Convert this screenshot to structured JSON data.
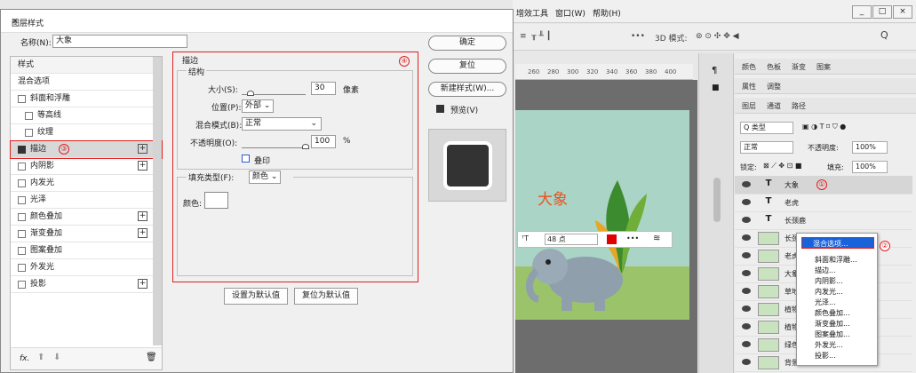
{
  "ps": {
    "menu": [
      "增效工具",
      "窗口(W)",
      "帮助(H)"
    ],
    "window_controls": [
      "_",
      "□",
      "×"
    ],
    "options": {
      "mode_3d": "3D 模式:",
      "more": "•••"
    },
    "ruler": [
      "260",
      "280",
      "300",
      "320",
      "340",
      "360",
      "380",
      "400"
    ],
    "canvas_title": "大象",
    "floatbar": {
      "font_size": "48 点",
      "more": "•••"
    },
    "panel_tabs_row1": [
      "颜色",
      "色板",
      "渐变",
      "图案"
    ],
    "panel_tabs_row2": [
      "属性",
      "调整"
    ],
    "panel_tabs_row3": [
      "图层",
      "通道",
      "路径"
    ],
    "kind_filter": "Q 类型",
    "blend_mode": "正常",
    "opacity_label": "不透明度:",
    "opacity_value": "100%",
    "lock_label": "锁定:",
    "fill_label": "填充:",
    "fill_value": "100%",
    "layers": [
      {
        "type": "T",
        "name": "大象",
        "badge": "①",
        "selected": true
      },
      {
        "type": "T",
        "name": "老虎"
      },
      {
        "type": "T",
        "name": "长颈鹿"
      },
      {
        "type": "img",
        "name": "长颈鹿"
      },
      {
        "type": "img",
        "name": "老虎"
      },
      {
        "type": "img",
        "name": "大象"
      },
      {
        "type": "img",
        "name": "草地"
      },
      {
        "type": "img",
        "name": "植物"
      },
      {
        "type": "img",
        "name": "植物"
      },
      {
        "type": "img",
        "name": "绿色背"
      },
      {
        "type": "img",
        "name": "背景"
      }
    ],
    "context_menu": {
      "first": "混合选项...",
      "badge": "②",
      "items": [
        "斜面和浮雕...",
        "描边...",
        "内阴影...",
        "内发光...",
        "光泽...",
        "颜色叠加...",
        "渐变叠加...",
        "图案叠加...",
        "外发光...",
        "投影..."
      ]
    }
  },
  "dialog": {
    "title": "图层样式",
    "close": "×",
    "name_label": "名称(N):",
    "name_value": "大象",
    "styles_header": "样式",
    "blend_options": "混合选项",
    "style_items": [
      {
        "label": "斜面和浮雕",
        "checked": false,
        "indent": 0,
        "plus": false
      },
      {
        "label": "等高线",
        "checked": false,
        "indent": 1,
        "plus": false
      },
      {
        "label": "纹理",
        "checked": false,
        "indent": 1,
        "plus": false
      },
      {
        "label": "描边",
        "checked": true,
        "indent": 0,
        "plus": true,
        "selected": true,
        "badge": "③"
      },
      {
        "label": "内阴影",
        "checked": false,
        "indent": 0,
        "plus": true
      },
      {
        "label": "内发光",
        "checked": false,
        "indent": 0,
        "plus": false
      },
      {
        "label": "光泽",
        "checked": false,
        "indent": 0,
        "plus": false
      },
      {
        "label": "颜色叠加",
        "checked": false,
        "indent": 0,
        "plus": true
      },
      {
        "label": "渐变叠加",
        "checked": false,
        "indent": 0,
        "plus": true
      },
      {
        "label": "图案叠加",
        "checked": false,
        "indent": 0,
        "plus": false
      },
      {
        "label": "外发光",
        "checked": false,
        "indent": 0,
        "plus": false
      },
      {
        "label": "投影",
        "checked": false,
        "indent": 0,
        "plus": true
      }
    ],
    "fx_label": "fx.",
    "section_title": "描边",
    "structure_title": "结构",
    "badge4": "④",
    "size_label": "大小(S):",
    "size_value": "30",
    "size_unit": "像素",
    "position_label": "位置(P):",
    "position_value": "外部",
    "blend_label": "混合模式(B):",
    "blend_value": "正常",
    "opacity_label": "不透明度(O):",
    "opacity_value": "100",
    "opacity_unit": "%",
    "overprint_label": "叠印",
    "fill_type_label": "填充类型(F):",
    "fill_type_value": "颜色",
    "color_label": "颜色:",
    "set_default": "设置为默认值",
    "reset_default": "复位为默认值",
    "ok": "确定",
    "reset": "复位",
    "new_style": "新建样式(W)...",
    "preview_label": "预览(V)",
    "preview_checked": true
  },
  "colors": {
    "accent_red": "#e02020",
    "menu_highlight": "#1a62d9",
    "stroke_swatch": "#ffffff"
  }
}
